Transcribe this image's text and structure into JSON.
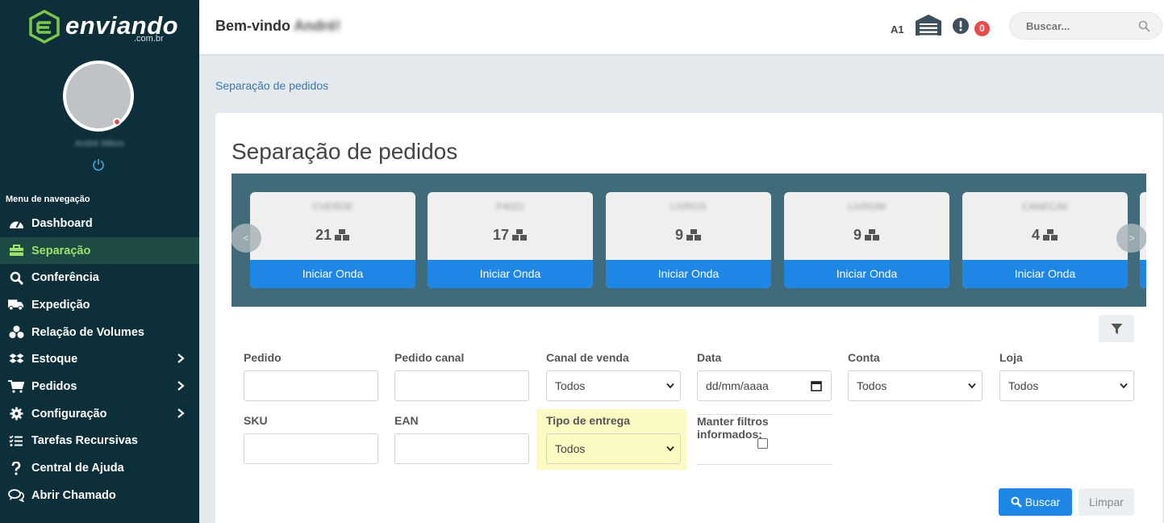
{
  "brand": {
    "name": "enviando",
    "sub": ".com.br"
  },
  "user": {
    "name": "André Mikos"
  },
  "menu_title": "Menu de navegação",
  "menu": [
    {
      "label": "Dashboard",
      "icon": "dashboard-icon"
    },
    {
      "label": "Separação",
      "icon": "toolbox-icon",
      "active": true
    },
    {
      "label": "Conferência",
      "icon": "search-icon"
    },
    {
      "label": "Expedição",
      "icon": "truck-icon"
    },
    {
      "label": "Relação de Volumes",
      "icon": "boxes-icon"
    },
    {
      "label": "Estoque",
      "icon": "dropbox-icon",
      "has_children": true
    },
    {
      "label": "Pedidos",
      "icon": "cart-icon",
      "has_children": true
    },
    {
      "label": "Configuração",
      "icon": "gear-icon",
      "has_children": true
    },
    {
      "label": "Tarefas Recursivas",
      "icon": "tasks-icon"
    },
    {
      "label": "Central de Ajuda",
      "icon": "question-icon"
    },
    {
      "label": "Abrir Chamado",
      "icon": "chat-icon"
    }
  ],
  "header": {
    "welcome": "Bem-vindo",
    "welcome_name": "André!",
    "warehouse_code": "A1",
    "alert_count": "0",
    "search_placeholder": "Buscar..."
  },
  "breadcrumb": "Separação de pedidos",
  "page_title": "Separação de pedidos",
  "waves": [
    {
      "code": "CVERDE",
      "count": "21",
      "button": "Iniciar Onda"
    },
    {
      "code": "P4021",
      "count": "17",
      "button": "Iniciar Onda"
    },
    {
      "code": "LIVROS",
      "count": "9",
      "button": "Iniciar Onda"
    },
    {
      "code": "LIVROM",
      "count": "9",
      "button": "Iniciar Onda"
    },
    {
      "code": "CANECAV",
      "count": "4",
      "button": "Iniciar Onda"
    }
  ],
  "carousel": {
    "prev": "<",
    "next": ">"
  },
  "filters": {
    "pedido": {
      "label": "Pedido",
      "value": ""
    },
    "pedido_canal": {
      "label": "Pedido canal",
      "value": ""
    },
    "canal_venda": {
      "label": "Canal de venda",
      "value": "Todos"
    },
    "data": {
      "label": "Data",
      "placeholder": "dd/mm/aaaa"
    },
    "conta": {
      "label": "Conta",
      "value": "Todos"
    },
    "loja": {
      "label": "Loja",
      "value": "Todos"
    },
    "sku": {
      "label": "SKU",
      "value": ""
    },
    "ean": {
      "label": "EAN",
      "value": ""
    },
    "tipo_entrega": {
      "label": "Tipo de entrega",
      "value": "Todos"
    },
    "manter": {
      "label": "Manter filtros informados:",
      "checked": false
    }
  },
  "buttons": {
    "buscar": "Buscar",
    "limpar": "Limpar"
  },
  "colors": {
    "sidebar": "#0d2f3a",
    "accent": "#1e87e5",
    "active_text": "#9be36a",
    "carousel_bg": "#3f6b7b",
    "highlight": "#fafac2",
    "badge": "#e74c4c"
  }
}
